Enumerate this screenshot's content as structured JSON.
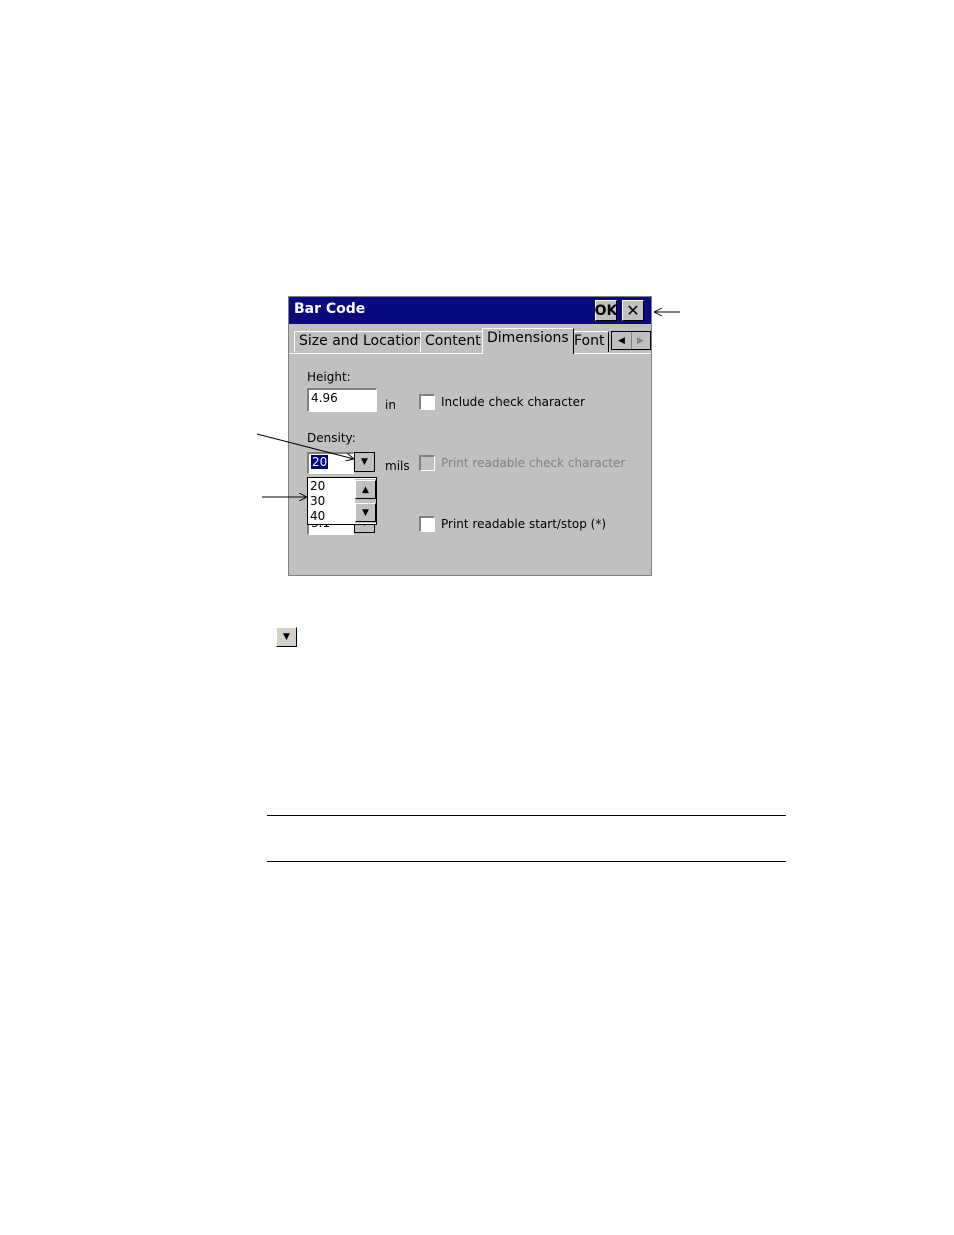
{
  "window": {
    "title": "Bar Code",
    "ok_label": "OK",
    "close_label": "✕"
  },
  "tabs": [
    {
      "label": "Size and Location"
    },
    {
      "label": "Content"
    },
    {
      "label": "Dimensions",
      "selected": true
    },
    {
      "label": "Font"
    }
  ],
  "tab_scroll": {
    "left": "◀",
    "right": "▶"
  },
  "form": {
    "height_label": "Height:",
    "height_value": "4.96",
    "height_unit": "in",
    "density_label": "Density:",
    "density_value": "20",
    "density_unit": "mils",
    "hidden_field_value": "3.1",
    "density_options": [
      "20",
      "30",
      "40"
    ],
    "check_include": "Include check character",
    "check_readable": "Print readable check character",
    "check_startstop": "Print readable start/stop (*)"
  },
  "icons": {
    "dropdown_arrow": "▼",
    "up_arrow": "▲",
    "down_arrow": "▼"
  },
  "colors": {
    "titlebar": "#0a0a80",
    "face": "#c0c0c0",
    "selection": "#000080"
  }
}
